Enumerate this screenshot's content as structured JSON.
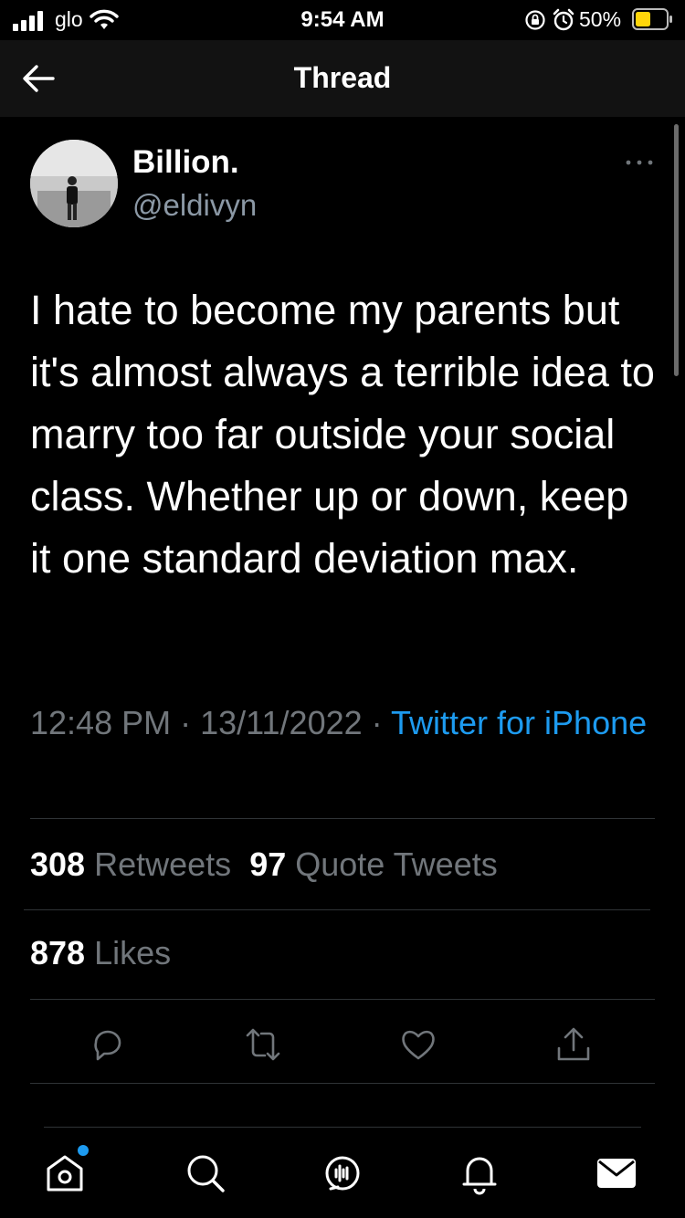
{
  "status_bar": {
    "carrier": "glo",
    "time": "9:54 AM",
    "battery": "50%"
  },
  "header": {
    "title": "Thread"
  },
  "tweet": {
    "author_name": "Billion.",
    "author_handle": "@eldivyn",
    "text": "I hate to become my parents but it's almost always a terrible idea to marry too far outside your social class. Whether up or down, keep it one standard deviation max.",
    "time": "12:48 PM",
    "date": "13/11/2022",
    "separator": "·",
    "source": "Twitter for iPhone",
    "retweets_count": "308",
    "retweets_label": "Retweets",
    "quotes_count": "97",
    "quotes_label": "Quote Tweets",
    "likes_count": "878",
    "likes_label": "Likes"
  },
  "colors": {
    "background": "#000000",
    "text": "#ffffff",
    "secondary_text": "#71767b",
    "link": "#1d9bf0",
    "battery_fill": "#ffd60a"
  },
  "icons": {
    "status": [
      "signal-icon",
      "wifi-icon",
      "orientation-lock-icon",
      "alarm-icon",
      "battery-icon"
    ],
    "header": [
      "back-arrow-icon"
    ],
    "actions": [
      "reply-icon",
      "retweet-icon",
      "like-icon",
      "share-icon"
    ],
    "tab_bar": [
      "home-icon",
      "search-icon",
      "spaces-icon",
      "notifications-icon",
      "messages-icon"
    ]
  }
}
